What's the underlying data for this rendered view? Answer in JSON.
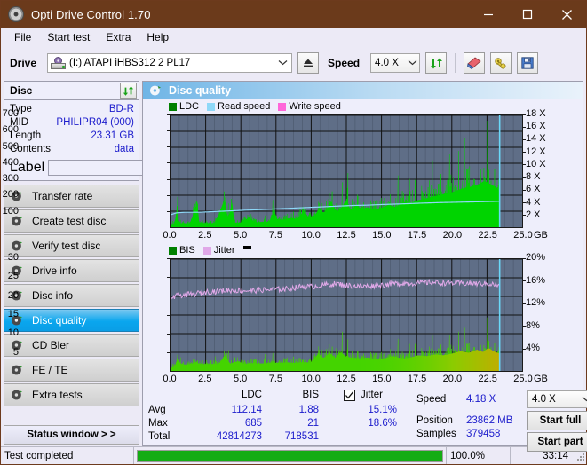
{
  "window": {
    "title": "Opti Drive Control 1.70",
    "title_icon": "disc-icon",
    "minimize": "─",
    "maximize": "☐",
    "close": "✕",
    "titlebar_color": "#6b3a1b"
  },
  "menu": {
    "items": [
      "File",
      "Start test",
      "Extra",
      "Help"
    ]
  },
  "toolbar": {
    "drive_label": "Drive",
    "drive_value": "(I:)  ATAPI iHBS312  2 PL17",
    "eject_icon": "eject-icon",
    "speed_label": "Speed",
    "speed_value": "4.0 X",
    "refresh_icon": "refresh-icon",
    "eraser_icon": "eraser-icon",
    "wrench_icon": "tools-icon",
    "save_icon": "save-icon"
  },
  "sidebar": {
    "disc_panel": {
      "title": "Disc",
      "refresh_icon": "refresh-icon",
      "rows": [
        {
          "label": "Type",
          "value": "BD-R"
        },
        {
          "label": "MID",
          "value": "PHILIPR04 (000)"
        },
        {
          "label": "Length",
          "value": "23.31 GB"
        },
        {
          "label": "Contents",
          "value": "data"
        }
      ],
      "label_label": "Label",
      "label_value": "",
      "label_placeholder": "",
      "label_button_icon": "disc-icon"
    },
    "nav": [
      {
        "label": "Transfer rate",
        "icon": "disc-test-icon",
        "selected": false
      },
      {
        "label": "Create test disc",
        "icon": "disc-test-icon",
        "selected": false
      },
      {
        "label": "Verify test disc",
        "icon": "disc-test-icon",
        "selected": false
      },
      {
        "label": "Drive info",
        "icon": "disc-test-icon",
        "selected": false
      },
      {
        "label": "Disc info",
        "icon": "disc-test-icon",
        "selected": false
      },
      {
        "label": "Disc quality",
        "icon": "disc-test-icon",
        "selected": true
      },
      {
        "label": "CD Bler",
        "icon": "disc-test-icon",
        "selected": false
      },
      {
        "label": "FE / TE",
        "icon": "disc-test-icon",
        "selected": false
      },
      {
        "label": "Extra tests",
        "icon": "disc-test-icon",
        "selected": false
      }
    ],
    "status_window_button": "Status window > >"
  },
  "panel": {
    "title": "Disc quality",
    "title_icon": "disc-test-icon"
  },
  "stats": {
    "col_ldc": "LDC",
    "col_bis": "BIS",
    "jitter_label": "Jitter",
    "jitter_checked": true,
    "rows": [
      {
        "name": "Avg",
        "ldc": "112.14",
        "bis": "1.88",
        "jitter": "15.1%"
      },
      {
        "name": "Max",
        "ldc": "685",
        "bis": "21",
        "jitter": "18.6%"
      },
      {
        "name": "Total",
        "ldc": "42814273",
        "bis": "718531",
        "jitter": ""
      }
    ],
    "speed_label": "Speed",
    "speed_value": "4.18 X",
    "position_label": "Position",
    "position_value": "23862 MB",
    "samples_label": "Samples",
    "samples_value": "379458",
    "speed_select": "4.0 X",
    "start_full": "Start full",
    "start_part": "Start part"
  },
  "statusbar": {
    "text": "Test completed",
    "progress_percent": 100.0,
    "progress_text": "100.0%",
    "elapsed": "33:14"
  },
  "chart_data": [
    {
      "id": "top",
      "type": "area",
      "title": "",
      "xlabel": "GB",
      "ylabel": "",
      "grid": true,
      "legend_position": "top-left",
      "legend": [
        {
          "name": "LDC",
          "color": "#008000"
        },
        {
          "name": "Read speed",
          "color": "#8ed8f8"
        },
        {
          "name": "Write speed",
          "color": "#ff66d9"
        }
      ],
      "x": [
        0.0,
        25.0
      ],
      "xticks": [
        "0.0",
        "2.5",
        "5.0",
        "7.5",
        "10.0",
        "12.5",
        "15.0",
        "17.5",
        "20.0",
        "22.5",
        "25.0"
      ],
      "ylim": [
        0,
        700
      ],
      "yticks": [
        "100",
        "200",
        "300",
        "400",
        "500",
        "600",
        "700"
      ],
      "y2lim": [
        0,
        18
      ],
      "y2ticks": [
        "2 X",
        "4 X",
        "6 X",
        "8 X",
        "10 X",
        "12 X",
        "14 X",
        "16 X",
        "18 X"
      ],
      "data_end_gb": 23.4,
      "series": [
        {
          "name": "LDC",
          "color": "#00d400",
          "kind": "area-spikes",
          "envelope": [
            [
              0.0,
              30
            ],
            [
              0.3,
              55
            ],
            [
              0.5,
              330
            ],
            [
              0.6,
              60
            ],
            [
              1.0,
              60
            ],
            [
              1.4,
              55
            ],
            [
              1.9,
              380
            ],
            [
              2.0,
              62
            ],
            [
              2.6,
              58
            ],
            [
              3.2,
              60
            ],
            [
              3.9,
              450
            ],
            [
              4.0,
              66
            ],
            [
              4.4,
              380
            ],
            [
              4.5,
              70
            ],
            [
              5.0,
              68
            ],
            [
              5.6,
              150
            ],
            [
              6.0,
              72
            ],
            [
              6.6,
              80
            ],
            [
              7.0,
              76
            ],
            [
              7.4,
              230
            ],
            [
              7.6,
              120
            ],
            [
              8.0,
              110
            ],
            [
              8.6,
              140
            ],
            [
              9.0,
              120
            ],
            [
              9.5,
              250
            ],
            [
              9.8,
              150
            ],
            [
              10.2,
              160
            ],
            [
              10.6,
              290
            ],
            [
              10.9,
              200
            ],
            [
              11.4,
              390
            ],
            [
              11.8,
              230
            ],
            [
              12.2,
              300
            ],
            [
              12.5,
              420
            ],
            [
              12.8,
              250
            ],
            [
              13.2,
              330
            ],
            [
              13.6,
              270
            ],
            [
              14.0,
              300
            ],
            [
              14.5,
              260
            ],
            [
              15.0,
              290
            ],
            [
              15.5,
              330
            ],
            [
              16.0,
              300
            ],
            [
              16.6,
              380
            ],
            [
              17.0,
              350
            ],
            [
              17.5,
              400
            ],
            [
              18.0,
              420
            ],
            [
              18.5,
              450
            ],
            [
              19.0,
              470
            ],
            [
              19.5,
              500
            ],
            [
              20.0,
              520
            ],
            [
              20.5,
              560
            ],
            [
              21.0,
              590
            ],
            [
              21.5,
              610
            ],
            [
              22.0,
              650
            ],
            [
              22.3,
              690
            ],
            [
              22.6,
              660
            ],
            [
              22.9,
              620
            ],
            [
              23.2,
              600
            ],
            [
              23.4,
              520
            ]
          ]
        },
        {
          "name": "Read speed",
          "color": "#8ed8f8",
          "kind": "line",
          "points": [
            [
              0.0,
              2.0
            ],
            [
              0.4,
              2.3
            ],
            [
              1.0,
              2.4
            ],
            [
              2.0,
              2.4
            ],
            [
              3.0,
              2.5
            ],
            [
              4.0,
              2.6
            ],
            [
              5.0,
              2.7
            ],
            [
              6.0,
              2.8
            ],
            [
              7.0,
              2.9
            ],
            [
              8.0,
              3.0
            ],
            [
              9.0,
              3.1
            ],
            [
              10.0,
              3.2
            ],
            [
              11.0,
              3.3
            ],
            [
              12.0,
              3.4
            ],
            [
              13.0,
              3.5
            ],
            [
              14.0,
              3.55
            ],
            [
              15.0,
              3.65
            ],
            [
              16.0,
              3.72
            ],
            [
              17.0,
              3.8
            ],
            [
              18.0,
              3.88
            ],
            [
              19.0,
              3.95
            ],
            [
              20.0,
              4.0
            ],
            [
              21.0,
              4.05
            ],
            [
              22.0,
              4.1
            ],
            [
              23.0,
              4.15
            ],
            [
              23.4,
              4.18
            ]
          ]
        },
        {
          "name": "Write speed",
          "color": "#ff66d9",
          "kind": "none",
          "points": []
        }
      ],
      "cursor_gb": 23.4,
      "cursor_color": "#6ad8f8"
    },
    {
      "id": "bottom",
      "type": "area",
      "title": "",
      "xlabel": "GB",
      "ylabel": "",
      "grid": true,
      "legend_position": "top-left",
      "legend": [
        {
          "name": "BIS",
          "color": "#008000"
        },
        {
          "name": "Jitter",
          "color": "#e0a8e8"
        }
      ],
      "x": [
        0.0,
        25.0
      ],
      "xticks": [
        "0.0",
        "2.5",
        "5.0",
        "7.5",
        "10.0",
        "12.5",
        "15.0",
        "17.5",
        "20.0",
        "22.5",
        "25.0"
      ],
      "ylim": [
        0,
        30
      ],
      "yticks": [
        "5",
        "10",
        "15",
        "20",
        "25",
        "30"
      ],
      "y2lim": [
        0,
        20
      ],
      "y2ticks": [
        "4%",
        "8%",
        "12%",
        "16%",
        "20%"
      ],
      "data_end_gb": 23.4,
      "series": [
        {
          "name": "BIS",
          "color": "#44d400",
          "kind": "area-spikes",
          "envelope": [
            [
              0.0,
              1.2
            ],
            [
              0.3,
              3.0
            ],
            [
              0.5,
              7.0
            ],
            [
              0.8,
              4.2
            ],
            [
              1.2,
              4.0
            ],
            [
              1.8,
              5.5
            ],
            [
              2.2,
              4.2
            ],
            [
              2.8,
              4.5
            ],
            [
              3.4,
              4.3
            ],
            [
              3.9,
              10.2
            ],
            [
              4.2,
              4.6
            ],
            [
              4.8,
              6.3
            ],
            [
              5.2,
              4.5
            ],
            [
              5.8,
              5.0
            ],
            [
              6.4,
              4.7
            ],
            [
              7.0,
              5.0
            ],
            [
              7.6,
              5.2
            ],
            [
              8.2,
              5.4
            ],
            [
              8.8,
              5.2
            ],
            [
              9.4,
              5.6
            ],
            [
              10.0,
              5.4
            ],
            [
              10.5,
              11.3
            ],
            [
              10.9,
              8.0
            ],
            [
              11.3,
              11.8
            ],
            [
              11.7,
              8.5
            ],
            [
              12.1,
              12.2
            ],
            [
              12.5,
              9.0
            ],
            [
              13.0,
              8.4
            ],
            [
              13.5,
              8.0
            ],
            [
              14.0,
              8.6
            ],
            [
              14.6,
              7.6
            ],
            [
              15.2,
              8.0
            ],
            [
              15.8,
              9.6
            ],
            [
              16.4,
              8.0
            ],
            [
              17.0,
              8.4
            ],
            [
              17.6,
              10.0
            ],
            [
              18.2,
              9.4
            ],
            [
              18.8,
              10.6
            ],
            [
              19.4,
              10.0
            ],
            [
              20.0,
              11.0
            ],
            [
              20.6,
              12.6
            ],
            [
              21.2,
              11.6
            ],
            [
              21.8,
              13.6
            ],
            [
              22.2,
              12.0
            ],
            [
              22.6,
              14.8
            ],
            [
              23.0,
              12.4
            ],
            [
              23.4,
              11.2
            ]
          ]
        },
        {
          "name": "Jitter",
          "color": "#e0a8e8",
          "kind": "noisy-line",
          "points": [
            [
              0.0,
              18.8
            ],
            [
              0.4,
              20.3
            ],
            [
              1.0,
              20.4
            ],
            [
              1.6,
              20.6
            ],
            [
              2.2,
              21.0
            ],
            [
              2.8,
              21.3
            ],
            [
              3.4,
              21.4
            ],
            [
              4.0,
              21.6
            ],
            [
              4.6,
              21.6
            ],
            [
              5.2,
              21.6
            ],
            [
              5.8,
              21.5
            ],
            [
              6.4,
              21.7
            ],
            [
              7.0,
              21.8
            ],
            [
              7.6,
              21.9
            ],
            [
              8.2,
              22.0
            ],
            [
              8.8,
              22.3
            ],
            [
              9.4,
              22.7
            ],
            [
              10.0,
              22.6
            ],
            [
              10.6,
              22.9
            ],
            [
              11.2,
              23.2
            ],
            [
              11.8,
              23.4
            ],
            [
              12.4,
              23.0
            ],
            [
              13.0,
              22.8
            ],
            [
              13.6,
              22.7
            ],
            [
              14.2,
              22.8
            ],
            [
              14.8,
              23.0
            ],
            [
              15.4,
              23.2
            ],
            [
              16.0,
              23.4
            ],
            [
              16.6,
              23.6
            ],
            [
              17.2,
              23.5
            ],
            [
              17.8,
              23.6
            ],
            [
              18.4,
              23.8
            ],
            [
              19.0,
              23.7
            ],
            [
              19.6,
              23.6
            ],
            [
              20.2,
              23.6
            ],
            [
              20.8,
              23.5
            ],
            [
              21.4,
              23.5
            ],
            [
              22.0,
              23.4
            ],
            [
              22.6,
              23.4
            ],
            [
              23.0,
              23.2
            ],
            [
              23.4,
              22.8
            ]
          ]
        }
      ],
      "cursor_gb": 23.4,
      "cursor_color": "#6ad8f8"
    }
  ]
}
